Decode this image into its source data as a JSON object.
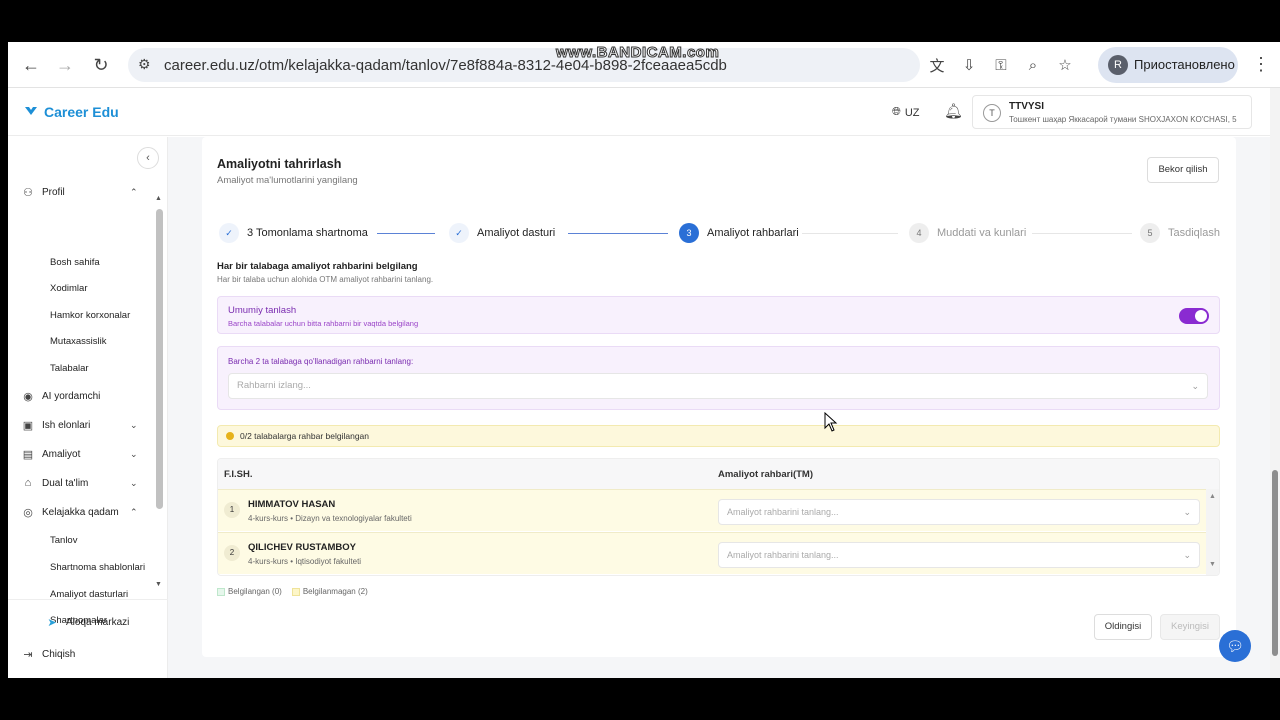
{
  "browser": {
    "url": "career.edu.uz/otm/kelajakka-qadam/tanlov/7e8f884a-8312-4e04-b898-2fceaaea5cdb",
    "profile_initial": "R",
    "profile_label": "Приостановлено",
    "watermark": "www.BANDICAM.com"
  },
  "app": {
    "logo": "Career Edu",
    "lang": "UZ",
    "org_name": "TTVYSI",
    "org_address": "Тошкент шаҳар Яккасарой тумани SHOXJAXON KO'CHASI, 5"
  },
  "sidebar": {
    "profil": "Profil",
    "profil_items": [
      "Bosh sahifa",
      "Xodimlar",
      "Hamkor korxonalar",
      "Mutaxassislik",
      "Talabalar"
    ],
    "ai": "AI yordamchi",
    "ish": "Ish elonlari",
    "amaliyot": "Amaliyot",
    "dual": "Dual ta'lim",
    "kelajakka": "Kelajakka qadam",
    "kelajakka_items": [
      "Tanlov",
      "Shartnoma shablonlari",
      "Amaliyot dasturlari",
      "Shartnomalar"
    ],
    "aloqa": "Aloqa markazi",
    "chiqish": "Chiqish"
  },
  "main": {
    "title": "Amaliyotni tahrirlash",
    "subtitle": "Amaliyot ma'lumotlarini yangilang",
    "cancel": "Bekor qilish",
    "steps": [
      {
        "num": "✓",
        "label": "3 Tomonlama shartnoma"
      },
      {
        "num": "✓",
        "label": "Amaliyot dasturi"
      },
      {
        "num": "3",
        "label": "Amaliyot rahbarlari"
      },
      {
        "num": "4",
        "label": "Muddati va kunlari"
      },
      {
        "num": "5",
        "label": "Tasdiqlash"
      }
    ],
    "section_title": "Har bir talabaga amaliyot rahbarini belgilang",
    "section_sub": "Har bir talaba uchun alohida OTM amaliyot rahbarini tanlang.",
    "general_title": "Umumiy tanlash",
    "general_sub": "Barcha talabalar uchun bitta rahbarni bir vaqtda belgilang",
    "bulk_label": "Barcha 2 ta talabaga qo'llanadigan rahbarni tanlang:",
    "bulk_placeholder": "Rahbarni izlang...",
    "warning": "0/2 talabalarga rahbar belgilangan",
    "col_name": "F.I.SH.",
    "col_supervisor": "Amaliyot rahbari(TM)",
    "rows": [
      {
        "num": "1",
        "name": "HIMMATOV HASAN",
        "meta": "4-kurs-kurs • Dizayn va texnologiyalar fakulteti",
        "placeholder": "Amaliyot rahbarini tanlang..."
      },
      {
        "num": "2",
        "name": "QILICHEV RUSTAMBOY",
        "meta": "4-kurs-kurs • Iqtisodiyot fakulteti",
        "placeholder": "Amaliyot rahbarini tanlang..."
      }
    ],
    "legend_assigned": "Belgilangan (0)",
    "legend_unassigned": "Belgilanmagan (2)",
    "prev": "Oldingisi",
    "next": "Keyingisi"
  },
  "colors": {
    "accent": "#2a6fd6",
    "purple": "#8a2bd1",
    "warning": "#e6b21a"
  }
}
